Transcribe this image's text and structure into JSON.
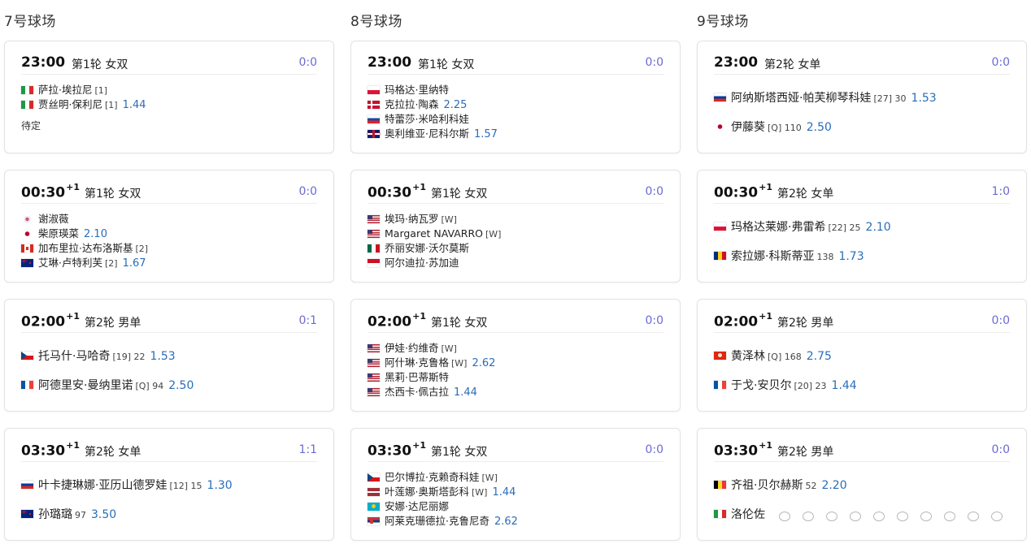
{
  "courts": [
    {
      "title": "7号球场",
      "matches": [
        {
          "time": "23:00",
          "plus": "",
          "round": "第1轮 女双",
          "score": "0:0",
          "layout": "small",
          "players": [
            {
              "flag": "it",
              "name": "萨拉·埃拉尼",
              "seed": "[1]",
              "odds": ""
            },
            {
              "flag": "it",
              "name": "贾丝明·保利尼",
              "seed": "[1]",
              "odds": "1.44"
            }
          ],
          "status": "待定"
        },
        {
          "time": "00:30",
          "plus": "+1",
          "round": "第1轮 女双",
          "score": "0:0",
          "layout": "small",
          "players": [
            {
              "flag": "tw",
              "name": "谢淑薇",
              "seed": "",
              "odds": ""
            },
            {
              "flag": "jp",
              "name": "柴原瑛菜",
              "seed": "",
              "odds": "2.10"
            },
            {
              "flag": "ca",
              "name": "加布里拉·达布洛斯基",
              "seed": "[2]",
              "odds": ""
            },
            {
              "flag": "nz",
              "name": "艾琳·卢特利芙",
              "seed": "[2]",
              "odds": "1.67"
            }
          ]
        },
        {
          "time": "02:00",
          "plus": "+1",
          "round": "第2轮 男单",
          "score": "0:1",
          "layout": "big",
          "players": [
            {
              "flag": "cz",
              "name": "托马什·马哈奇",
              "seed": "[19] 22",
              "odds": "1.53"
            },
            {
              "flag": "fr",
              "name": "阿德里安·曼纳里诺",
              "seed": "[Q] 94",
              "odds": "2.50"
            }
          ]
        },
        {
          "time": "03:30",
          "plus": "+1",
          "round": "第2轮 女单",
          "score": "1:1",
          "layout": "big",
          "players": [
            {
              "flag": "ru",
              "name": "叶卡捷琳娜·亚历山德罗娃",
              "seed": "[12] 15",
              "odds": "1.30"
            },
            {
              "flag": "nz",
              "name": "孙璐璐",
              "seed": "97",
              "odds": "3.50"
            }
          ]
        }
      ]
    },
    {
      "title": "8号球场",
      "matches": [
        {
          "time": "23:00",
          "plus": "",
          "round": "第1轮 女双",
          "score": "0:0",
          "layout": "small",
          "players": [
            {
              "flag": "pl",
              "name": "玛格达·里纳特",
              "seed": "",
              "odds": ""
            },
            {
              "flag": "dk",
              "name": "克拉拉·陶森",
              "seed": "",
              "odds": "2.25"
            },
            {
              "flag": "sk",
              "name": "特蕾莎·米哈利科娃",
              "seed": "",
              "odds": ""
            },
            {
              "flag": "gb",
              "name": "奥利维亚·尼科尔斯",
              "seed": "",
              "odds": "1.57"
            }
          ]
        },
        {
          "time": "00:30",
          "plus": "+1",
          "round": "第1轮 女双",
          "score": "0:0",
          "layout": "small",
          "players": [
            {
              "flag": "us",
              "name": "埃玛·纳瓦罗",
              "seed": "[W]",
              "odds": ""
            },
            {
              "flag": "us",
              "name": "Margaret NAVARRO",
              "seed": "[W]",
              "odds": ""
            },
            {
              "flag": "mx",
              "name": "乔丽安娜·沃尔莫斯",
              "seed": "",
              "odds": ""
            },
            {
              "flag": "id",
              "name": "阿尔迪拉·苏加迪",
              "seed": "",
              "odds": ""
            }
          ]
        },
        {
          "time": "02:00",
          "plus": "+1",
          "round": "第1轮 女双",
          "score": "0:0",
          "layout": "small",
          "players": [
            {
              "flag": "us",
              "name": "伊娃·约维奇",
              "seed": "[W]",
              "odds": ""
            },
            {
              "flag": "us",
              "name": "阿什琳·克鲁格",
              "seed": "[W]",
              "odds": "2.62"
            },
            {
              "flag": "us",
              "name": "黑莉·巴蒂斯特",
              "seed": "",
              "odds": ""
            },
            {
              "flag": "us",
              "name": "杰西卡·佩古拉",
              "seed": "",
              "odds": "1.44"
            }
          ]
        },
        {
          "time": "03:30",
          "plus": "+1",
          "round": "第1轮 女双",
          "score": "0:0",
          "layout": "small",
          "players": [
            {
              "flag": "cz",
              "name": "巴尔博拉·克赖奇科娃",
              "seed": "[W]",
              "odds": ""
            },
            {
              "flag": "lv",
              "name": "叶莲娜·奥斯塔彭科",
              "seed": "[W]",
              "odds": "1.44"
            },
            {
              "flag": "kz",
              "name": "安娜·达尼丽娜",
              "seed": "",
              "odds": ""
            },
            {
              "flag": "rs",
              "name": "阿莱克珊德拉·克鲁尼奇",
              "seed": "",
              "odds": "2.62"
            }
          ]
        }
      ]
    },
    {
      "title": "9号球场",
      "matches": [
        {
          "time": "23:00",
          "plus": "",
          "round": "第2轮 女单",
          "score": "0:0",
          "layout": "big",
          "players": [
            {
              "flag": "ru",
              "name": "阿纳斯塔西娅·帕芙柳琴科娃",
              "seed": "[27] 30",
              "odds": "1.53"
            },
            {
              "flag": "jp",
              "name": "伊藤葵",
              "seed": "[Q] 110",
              "odds": "2.50"
            }
          ]
        },
        {
          "time": "00:30",
          "plus": "+1",
          "round": "第2轮 女单",
          "score": "1:0",
          "layout": "big",
          "players": [
            {
              "flag": "pl",
              "name": "玛格达莱娜·弗雷希",
              "seed": "[22] 25",
              "odds": "2.10"
            },
            {
              "flag": "ro",
              "name": "索拉娜·科斯蒂亚",
              "seed": "138",
              "odds": "1.73"
            }
          ]
        },
        {
          "time": "02:00",
          "plus": "+1",
          "round": "第2轮 男单",
          "score": "0:0",
          "layout": "big",
          "players": [
            {
              "flag": "hk",
              "name": "黄泽林",
              "seed": "[Q] 168",
              "odds": "2.75"
            },
            {
              "flag": "fr",
              "name": "于戈·安贝尔",
              "seed": "[20] 23",
              "odds": "1.44"
            }
          ]
        },
        {
          "time": "03:30",
          "plus": "+1",
          "round": "第2轮 男单",
          "score": "0:0",
          "layout": "big",
          "players": [
            {
              "flag": "be",
              "name": "齐祖·贝尔赫斯",
              "seed": "52",
              "odds": "2.20"
            },
            {
              "flag": "it",
              "name": "洛伦佐",
              "seed": "",
              "odds": ""
            }
          ]
        }
      ]
    }
  ]
}
